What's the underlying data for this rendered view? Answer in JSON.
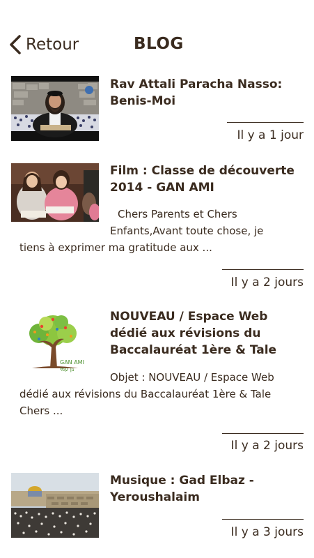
{
  "header": {
    "back_label": "Retour",
    "title": "BLOG"
  },
  "posts": [
    {
      "title_line1": "Rav Attali Paracha Nasso:",
      "title_line2": "Benis-Moi",
      "date": "Il y a 1 jour",
      "thumb_icon": "rabbi-video-thumbnail"
    },
    {
      "title_line1": "Film : Classe de découverte",
      "title_line2": "2014 - GAN AMI",
      "excerpt_line1": "Chers Parents et Chers",
      "excerpt_line2": "Enfants,Avant toute chose, je",
      "excerpt_line3": "tiens à exprimer ma gratitude aux ...",
      "date": "Il y a 2 jours",
      "thumb_icon": "children-reading-photo"
    },
    {
      "title_line1": "NOUVEAU / Espace Web",
      "title_line2": "dédié aux révisions du",
      "title_line3": "Baccalauréat 1ère & Tale",
      "excerpt_line1": "Objet : NOUVEAU / Espace Web",
      "excerpt_line2": "dédié aux révisions du Baccalauréat 1ère & Tale",
      "excerpt_line3": "Chers ...",
      "date": "Il y a 2 jours",
      "logo_text_latin": "GAN AMI",
      "logo_text_hebrew": "גן עמי",
      "thumb_icon": "gan-ami-tree-logo"
    },
    {
      "title_line1": "Musique : Gad Elbaz -",
      "title_line2": "Yeroushalaim",
      "date": "Il y a 3 jours",
      "thumb_icon": "jerusalem-western-wall-photo"
    }
  ]
}
